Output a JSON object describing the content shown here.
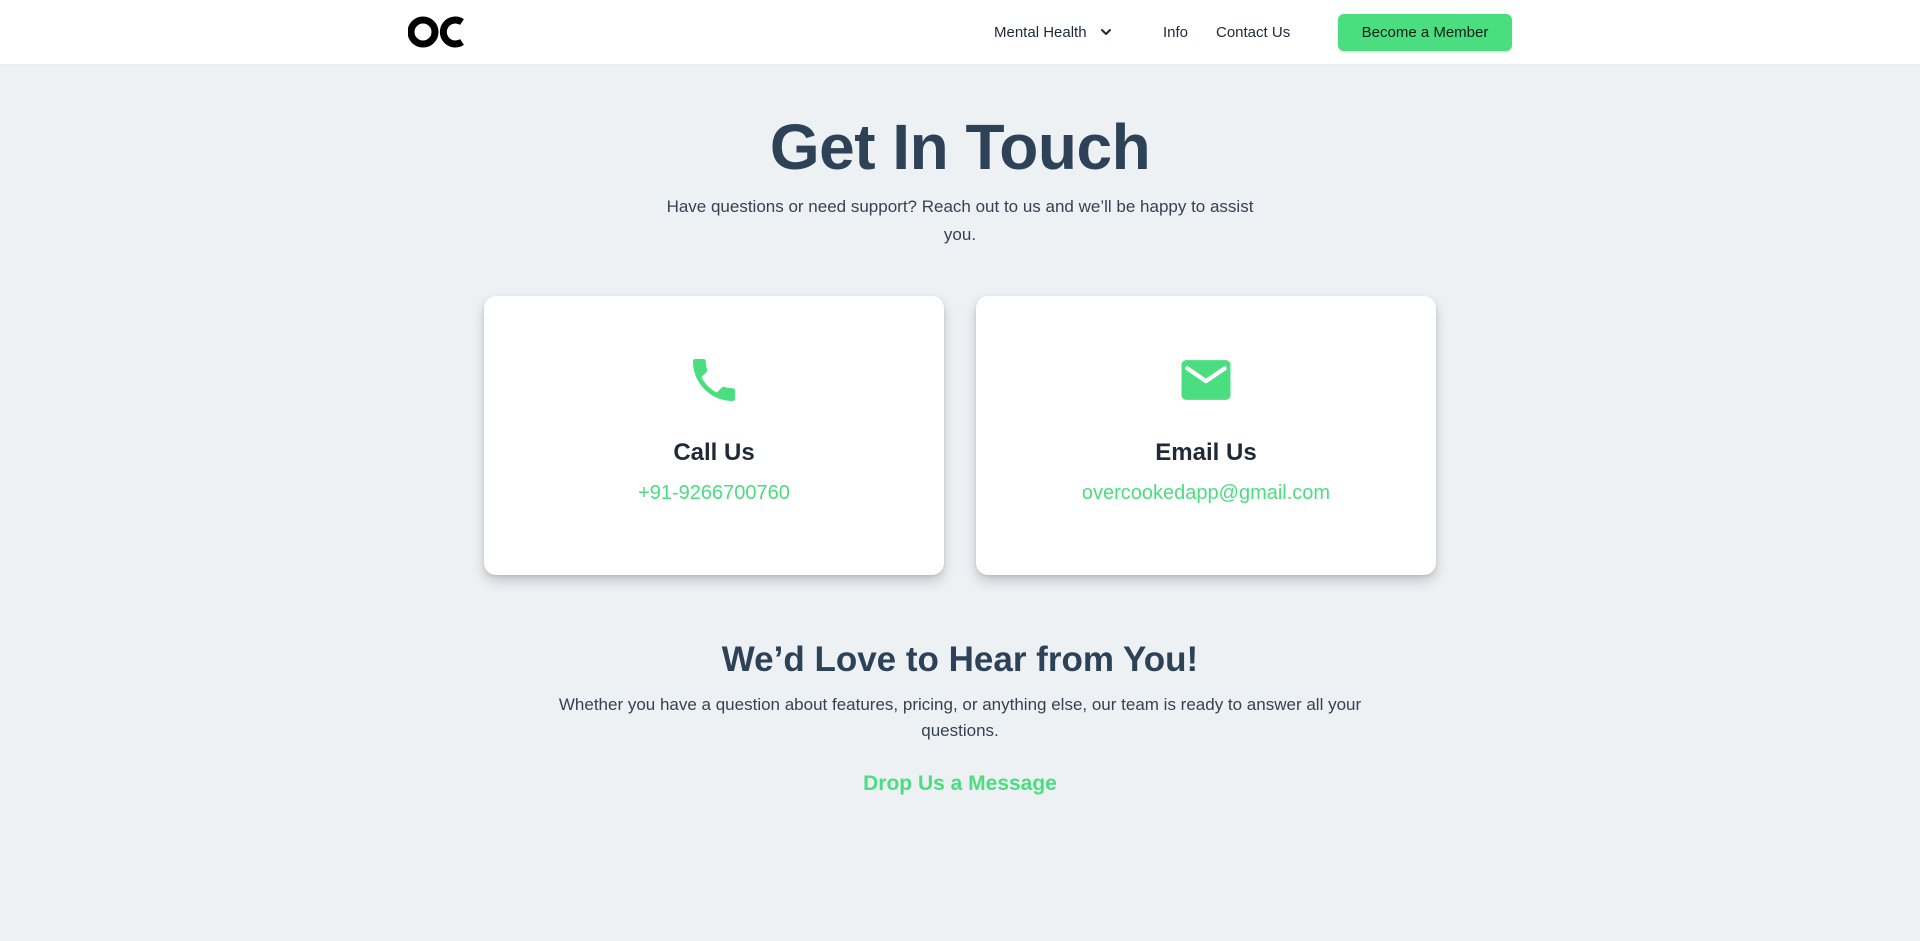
{
  "header": {
    "logo_text": "OC",
    "nav": {
      "mental_health": "Mental Health",
      "info": "Info",
      "contact": "Contact Us"
    },
    "cta_label": "Become a Member"
  },
  "hero": {
    "title": "Get In Touch",
    "subtitle": "Have questions or need support? Reach out to us and we’ll be happy to assist you."
  },
  "cards": {
    "call": {
      "icon": "phone-icon",
      "title": "Call Us",
      "value": "+91-9266700760"
    },
    "email": {
      "icon": "envelope-icon",
      "title": "Email Us",
      "value": "overcookedapp@gmail.com"
    }
  },
  "message_section": {
    "title": "We’d Love to Hear from You!",
    "subtitle": "Whether you have a question about features, pricing, or anything else, our team is ready to answer all your questions.",
    "link_label": "Drop Us a Message"
  },
  "colors": {
    "accent": "#4ade80",
    "heading": "#2d4257",
    "background": "#edf1f4"
  }
}
